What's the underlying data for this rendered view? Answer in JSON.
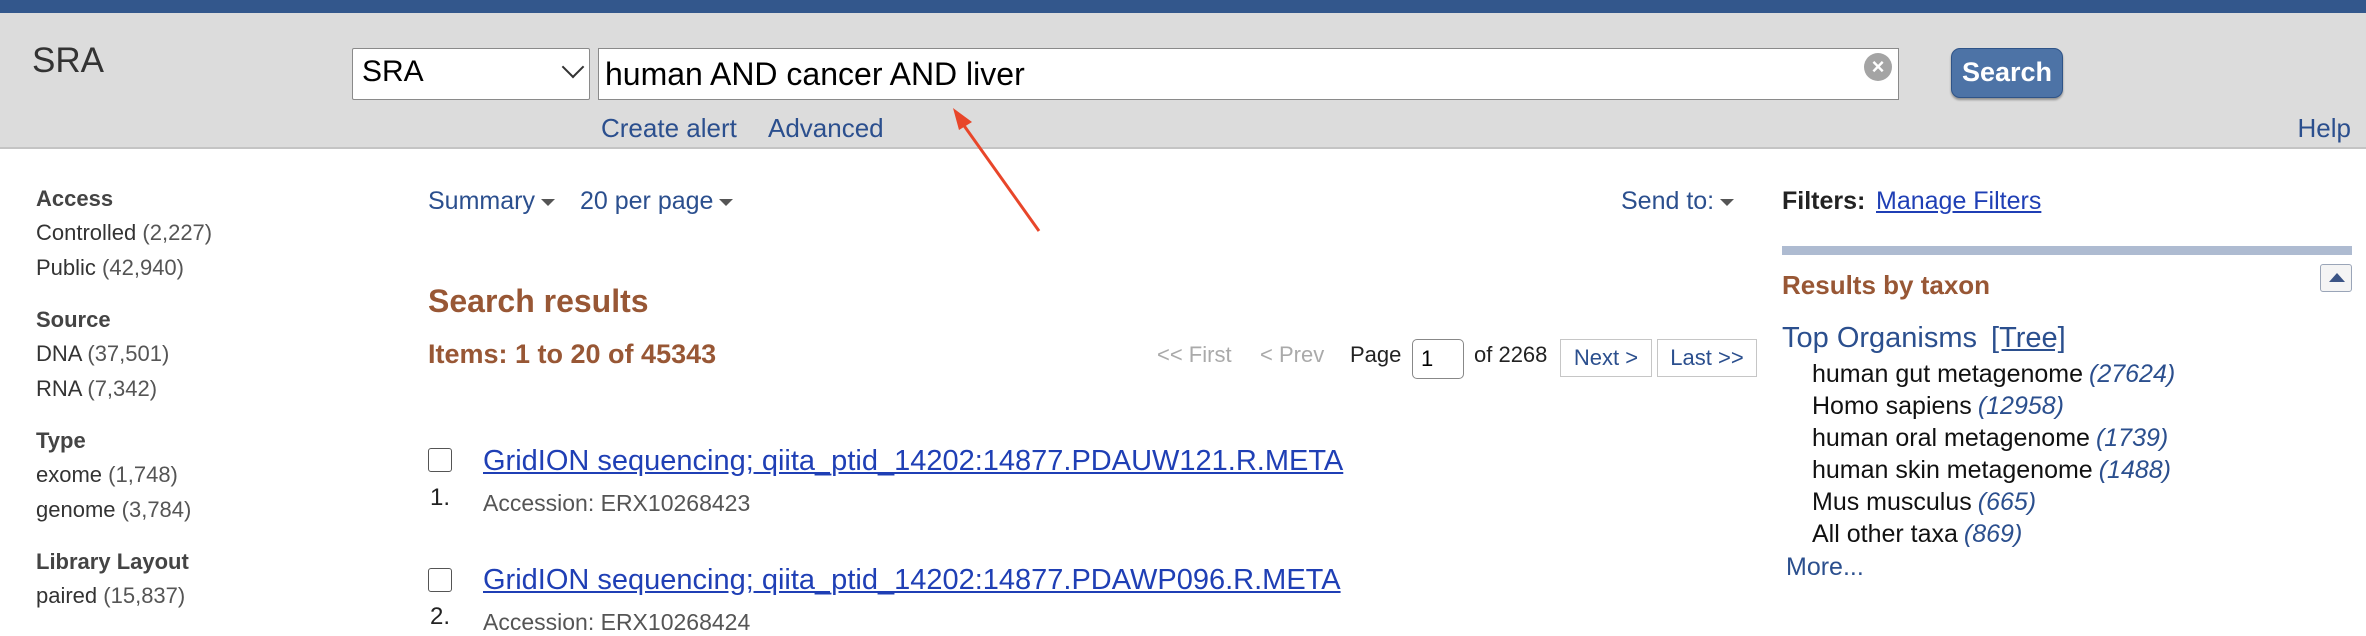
{
  "header": {
    "app_title": "SRA",
    "db_select": "SRA",
    "search_query": "human AND cancer AND liver",
    "search_button": "Search",
    "create_alert": "Create alert",
    "advanced": "Advanced",
    "help": "Help"
  },
  "sidebar": {
    "groups": [
      {
        "title": "Access",
        "items": [
          {
            "label": "Controlled",
            "count": "(2,227)"
          },
          {
            "label": "Public",
            "count": "(42,940)"
          }
        ]
      },
      {
        "title": "Source",
        "items": [
          {
            "label": "DNA",
            "count": "(37,501)"
          },
          {
            "label": "RNA",
            "count": "(7,342)"
          }
        ]
      },
      {
        "title": "Type",
        "items": [
          {
            "label": "exome",
            "count": "(1,748)"
          },
          {
            "label": "genome",
            "count": "(3,784)"
          }
        ]
      },
      {
        "title": "Library Layout",
        "items": [
          {
            "label": "paired",
            "count": "(15,837)"
          }
        ]
      }
    ]
  },
  "toolbar": {
    "summary": "Summary",
    "per_page": "20 per page",
    "send_to": "Send to:"
  },
  "results": {
    "title": "Search results",
    "items_count": "Items: 1 to 20 of 45343",
    "pager": {
      "first": "<< First",
      "prev": "< Prev",
      "page_label": "Page",
      "page_value": "1",
      "of_pages": "of 2268",
      "next": "Next >",
      "last": "Last >>"
    },
    "rows": [
      {
        "num": "1.",
        "title": "GridION sequencing; qiita_ptid_14202:14877.PDAUW121.R.META",
        "accession": "Accession: ERX10268423"
      },
      {
        "num": "2.",
        "title": "GridION sequencing; qiita_ptid_14202:14877.PDAWP096.R.META",
        "accession": "Accession: ERX10268424"
      }
    ]
  },
  "filters": {
    "label": "Filters:",
    "manage": "Manage Filters"
  },
  "taxon": {
    "title": "Results by taxon",
    "top_organisms": "Top Organisms",
    "tree": "[Tree]",
    "items": [
      {
        "name": "human gut metagenome",
        "count": "(27624)"
      },
      {
        "name": "Homo sapiens",
        "count": "(12958)"
      },
      {
        "name": "human oral metagenome",
        "count": "(1739)"
      },
      {
        "name": "human skin metagenome",
        "count": "(1488)"
      },
      {
        "name": "Mus musculus",
        "count": "(665)"
      },
      {
        "name": "All other taxa",
        "count": "(869)"
      }
    ],
    "more": "More..."
  },
  "colors": {
    "topbar": "#33578c",
    "header_bg": "#dcdcdc",
    "link": "#2b4f8e",
    "accent_brown": "#985735",
    "arrow": "#e8462a"
  }
}
